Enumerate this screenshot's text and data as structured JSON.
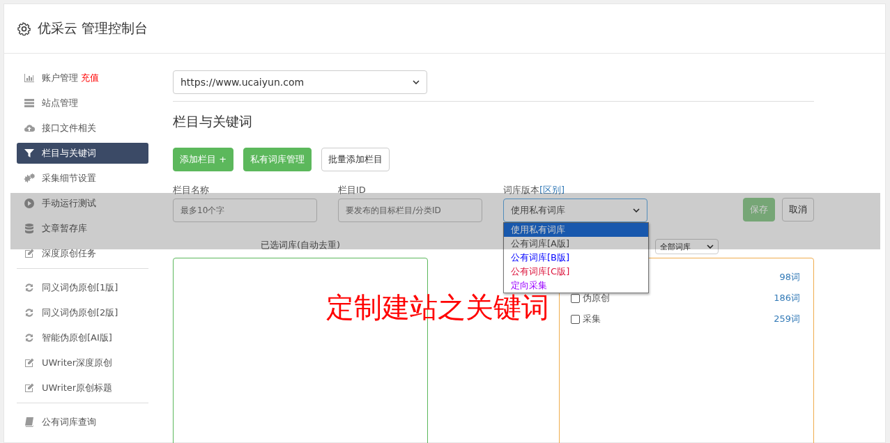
{
  "header": {
    "title": "优采云 管理控制台"
  },
  "sidebar": {
    "groups": [
      {
        "items": [
          {
            "label": "账户管理",
            "badge": "充值",
            "selected": false
          },
          {
            "label": "站点管理",
            "selected": false
          },
          {
            "label": "接口文件相关",
            "selected": false
          },
          {
            "label": "栏目与关键词",
            "selected": true
          },
          {
            "label": "采集细节设置",
            "selected": false
          },
          {
            "label": "手动运行测试",
            "selected": false
          },
          {
            "label": "文章暂存库",
            "selected": false
          },
          {
            "label": "深度原创任务",
            "selected": false
          }
        ]
      },
      {
        "items": [
          {
            "label": "同义词伪原创[1版]",
            "selected": false
          },
          {
            "label": "同义词伪原创[2版]",
            "selected": false
          },
          {
            "label": "智能伪原创[AI版]",
            "selected": false
          },
          {
            "label": "UWriter深度原创",
            "selected": false
          },
          {
            "label": "UWriter原创标题",
            "selected": false
          }
        ]
      },
      {
        "items": [
          {
            "label": "公有词库查询",
            "selected": false
          }
        ]
      }
    ]
  },
  "main": {
    "site_select": {
      "value": "https://www.ucaiyun.com"
    },
    "section_title": "栏目与关键词",
    "buttons": [
      {
        "label": "添加栏目 +",
        "kind": "primary"
      },
      {
        "label": "私有词库管理",
        "kind": "primary"
      },
      {
        "label": "批量添加栏目",
        "kind": "default"
      }
    ],
    "form": {
      "name_field": {
        "label": "栏目名称",
        "placeholder": "最多10个字"
      },
      "id_field": {
        "label": "栏目ID",
        "placeholder": "要发布的目标栏目/分类ID"
      },
      "version_field": {
        "label": "词库版本",
        "link": "[区别]",
        "value": "使用私有词库",
        "expanded": true,
        "options": [
          {
            "label": "使用私有词库",
            "selected": true
          },
          {
            "label": "公有词库[A版]",
            "color": "#555555",
            "selected": false
          },
          {
            "label": "公有词库[B版]",
            "color": "#0000ff",
            "selected": false
          },
          {
            "label": "公有词库[C版]",
            "color": "#dc143c",
            "selected": false
          },
          {
            "label": "定向采集",
            "color": "#9900ff",
            "selected": false
          }
        ]
      },
      "save_button": "保存",
      "cancel_button": "取消"
    },
    "selected_panel": {
      "title": "已选词库(自动去重)"
    },
    "library_panel": {
      "filter": "全部词库",
      "rows": [
        {
          "count": "98词"
        },
        {
          "label": "伪原创",
          "count": "186词",
          "checked": false
        },
        {
          "label": "采集",
          "count": "259词",
          "checked": false
        }
      ]
    }
  },
  "annotation": "定制建站之关键词"
}
